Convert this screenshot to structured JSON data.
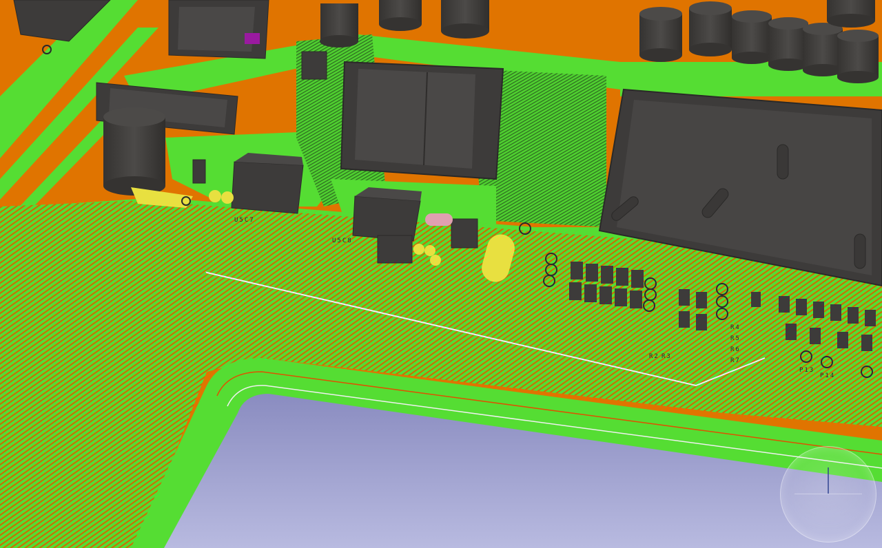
{
  "app": {
    "view": "pcb-3d-view"
  },
  "board": {
    "colors": {
      "copper_pour": "#e07400",
      "solder_mask_trace": "#55dd33",
      "component_body": "#3d3b3a",
      "component_top": "#4a4847",
      "board_cutout": "#9ea0d0",
      "pad_yellow": "#e8e040",
      "pad_pink": "#e0a0b0",
      "pad_purple": "#9a1aa0"
    }
  },
  "silkscreen": {
    "u_label_1": "U5C7",
    "u_label_2": "U5C8",
    "r_labels": [
      "R2",
      "R3",
      "R4",
      "R5",
      "R6",
      "R7"
    ],
    "p_labels": [
      "P13",
      "P14"
    ]
  },
  "navigation": {
    "cube_icon": "view-navigation-cube-icon"
  }
}
